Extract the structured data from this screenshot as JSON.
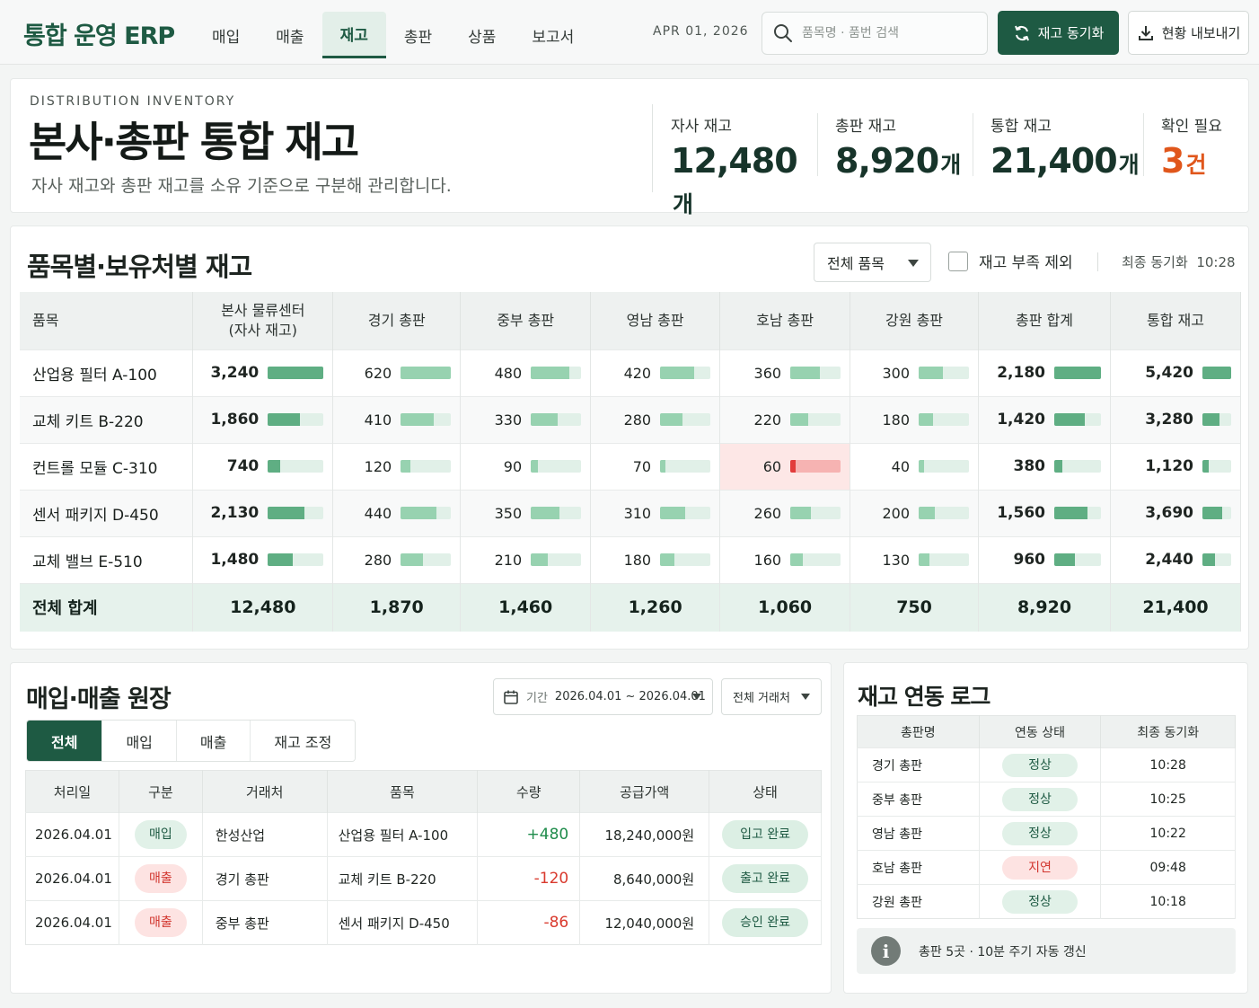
{
  "app": {
    "title": "통합 운영 ERP"
  },
  "nav": {
    "items": [
      "매입",
      "매출",
      "재고",
      "총판",
      "상품",
      "보고서"
    ],
    "active_index": 2
  },
  "header": {
    "date": "APR 01, 2026",
    "search_placeholder": "품목명 · 품번 검색",
    "sync_button": "재고 동기화",
    "export_button": "현황 내보내기"
  },
  "hero": {
    "eyebrow": "DISTRIBUTION INVENTORY",
    "title": "본사·총판 통합 재고",
    "description": "자사 재고와 총판 재고를 소유 기준으로 구분해 관리합니다.",
    "kpis": [
      {
        "label": "자사 재고",
        "value": "12,480",
        "unit": "개"
      },
      {
        "label": "총판 재고",
        "value": "8,920",
        "unit": "개"
      },
      {
        "label": "통합 재고",
        "value": "21,400",
        "unit": "개"
      },
      {
        "label": "확인 필요",
        "value": "3",
        "unit": "건"
      }
    ]
  },
  "stock": {
    "title": "품목별·보유처별 재고",
    "filter_select": "전체 품목",
    "exclude_label": "재고 부족 제외",
    "last_sync_label": "최종 동기화",
    "last_sync_time": "10:28",
    "columns": [
      "품목",
      "본사 물류센터\n(자사 재고)",
      "경기 총판",
      "중부 총판",
      "영남 총판",
      "호남 총판",
      "강원 총판",
      "총판 합계",
      "통합 재고"
    ],
    "rows": [
      {
        "name": "산업용 필터 A-100",
        "values": [
          3240,
          620,
          480,
          420,
          360,
          300,
          2180,
          5420
        ]
      },
      {
        "name": "교체 키트 B-220",
        "values": [
          1860,
          410,
          330,
          280,
          220,
          180,
          1420,
          3280
        ]
      },
      {
        "name": "컨트롤 모듈 C-310",
        "values": [
          740,
          120,
          90,
          70,
          60,
          40,
          380,
          1120
        ],
        "alert_col": 4
      },
      {
        "name": "센서 패키지 D-450",
        "values": [
          2130,
          440,
          350,
          310,
          260,
          200,
          1560,
          3690
        ]
      },
      {
        "name": "교체 밸브 E-510",
        "values": [
          1480,
          280,
          210,
          180,
          160,
          130,
          960,
          2440
        ]
      }
    ],
    "total": {
      "label": "전체 합계",
      "values": [
        "12,480",
        "1,870",
        "1,460",
        "1,260",
        "1,060",
        "750",
        "8,920",
        "21,400"
      ]
    }
  },
  "ledger": {
    "title": "매입·매출 원장",
    "period_label": "기간",
    "period_value": "2026.04.01 ~ 2026.04.01",
    "partner_select": "전체 거래처",
    "tabs": [
      "전체",
      "매입",
      "매출",
      "재고 조정"
    ],
    "active_tab": 0,
    "columns": [
      "처리일",
      "구분",
      "거래처",
      "품목",
      "수량",
      "공급가액",
      "상태"
    ],
    "rows": [
      {
        "date": "2026.04.01",
        "type": "매입",
        "type_kind": "buy",
        "partner": "한성산업",
        "item": "산업용 필터 A-100",
        "qty": "+480",
        "amount": "18,240,000원",
        "status": "입고 완료"
      },
      {
        "date": "2026.04.01",
        "type": "매출",
        "type_kind": "sell",
        "partner": "경기 총판",
        "item": "교체 키트 B-220",
        "qty": "-120",
        "amount": "8,640,000원",
        "status": "출고 완료"
      },
      {
        "date": "2026.04.01",
        "type": "매출",
        "type_kind": "sell",
        "partner": "중부 총판",
        "item": "센서 패키지 D-450",
        "qty": "-86",
        "amount": "12,040,000원",
        "status": "승인 완료"
      }
    ]
  },
  "sync_log": {
    "title": "재고 연동 로그",
    "columns": [
      "총판명",
      "연동 상태",
      "최종 동기화"
    ],
    "rows": [
      {
        "name": "경기 총판",
        "status": "정상",
        "kind": "ok",
        "time": "10:28"
      },
      {
        "name": "중부 총판",
        "status": "정상",
        "kind": "ok",
        "time": "10:25"
      },
      {
        "name": "영남 총판",
        "status": "정상",
        "kind": "ok",
        "time": "10:22"
      },
      {
        "name": "호남 총판",
        "status": "지연",
        "kind": "bad",
        "time": "09:48"
      },
      {
        "name": "강원 총판",
        "status": "정상",
        "kind": "ok",
        "time": "10:18"
      }
    ],
    "note": "총판 5곳 · 10분 주기 자동 갱신"
  },
  "colors": {
    "primary": "#1e5a43",
    "warning": "#e0561b",
    "alert": "#e23c3c",
    "bar": "#5fae83"
  },
  "icons": {
    "search": "search-icon",
    "sync": "refresh-icon",
    "export": "download-icon",
    "calendar": "calendar-icon",
    "info": "info-icon"
  }
}
